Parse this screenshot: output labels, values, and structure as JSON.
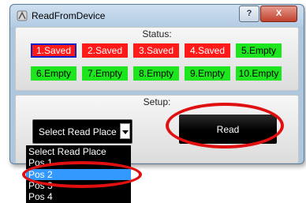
{
  "window": {
    "title": "ReadFromDevice",
    "help_label": "?",
    "close_label": "X"
  },
  "status": {
    "label": "Status:",
    "slots": [
      {
        "text": "1.Saved",
        "state": "saved",
        "selected": true
      },
      {
        "text": "2.Saved",
        "state": "saved",
        "selected": false
      },
      {
        "text": "3.Saved",
        "state": "saved",
        "selected": false
      },
      {
        "text": "4.Saved",
        "state": "saved",
        "selected": false
      },
      {
        "text": "5.Empty",
        "state": "empty",
        "selected": false
      },
      {
        "text": "6.Empty",
        "state": "empty",
        "selected": false
      },
      {
        "text": "7.Empty",
        "state": "empty",
        "selected": false
      },
      {
        "text": "8.Empty",
        "state": "empty",
        "selected": false
      },
      {
        "text": "9.Empty",
        "state": "empty",
        "selected": false
      },
      {
        "text": "10.Empty",
        "state": "empty",
        "selected": false
      }
    ],
    "colors": {
      "saved": "#ff1a1a",
      "empty": "#1ee61e",
      "selected_border": "#1020c8"
    }
  },
  "setup": {
    "label": "Setup:",
    "select_value": "Select Read Place",
    "read_label": "Read"
  },
  "dropdown": {
    "options": [
      "Select Read Place",
      "Pos 1",
      "Pos 2",
      "Pos 3",
      "Pos 4"
    ],
    "highlighted": "Pos 2",
    "highlight_color": "#3399ff"
  },
  "annotation_color": "#e11010"
}
